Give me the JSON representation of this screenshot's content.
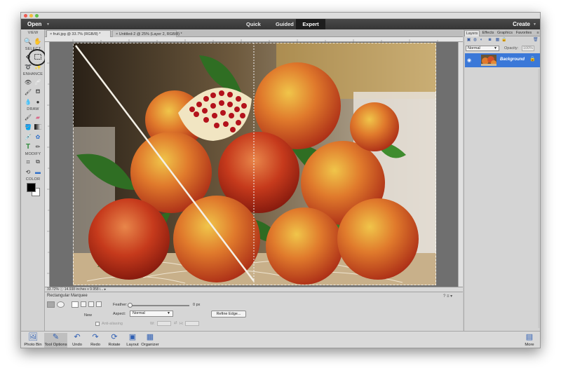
{
  "menubar": {
    "open": "Open",
    "modes": [
      "Quick",
      "Guided",
      "Expert"
    ],
    "create": "Create"
  },
  "toolbox": {
    "sections": [
      "VIEW",
      "SELECT",
      "ENHANCE",
      "DRAW",
      "MODIFY",
      "COLOR"
    ]
  },
  "document_tabs": [
    "fruit.jpg @ 33.7% (RGB/8) *",
    "Untitled-2 @ 25% (Layer 2, RGB/8) *"
  ],
  "status": {
    "zoom": "33.72%",
    "doc_size": "14.938 inches x 9.958 i..."
  },
  "tool_options": {
    "tool_name": "Rectangular Marquee",
    "new_label": "New",
    "feather_label": "Feather:",
    "feather_value": "0 px",
    "aspect_label": "Aspect:",
    "aspect_value": "Normal",
    "anti_aliasing": "Anti-aliasing",
    "w_label": "W:",
    "h_label": "H:",
    "refine_edge": "Refine Edge..."
  },
  "panel": {
    "tabs": [
      "Layers",
      "Effects",
      "Graphics",
      "Favorites"
    ],
    "blend_mode": "Normal",
    "opacity_label": "Opacity:",
    "opacity_value": "100%",
    "layer_name": "Background"
  },
  "taskbar": {
    "photo_bin": "Photo Bin",
    "tool_options": "Tool Options",
    "undo": "Undo",
    "redo": "Redo",
    "rotate": "Rotate",
    "layout": "Layout",
    "organizer": "Organizer",
    "more": "More"
  },
  "colors": {
    "accent": "#3b78d8",
    "menubar": "#3d3d3d",
    "expert_tab": "#1d1d1d",
    "workspace": "#6f6f6f"
  }
}
